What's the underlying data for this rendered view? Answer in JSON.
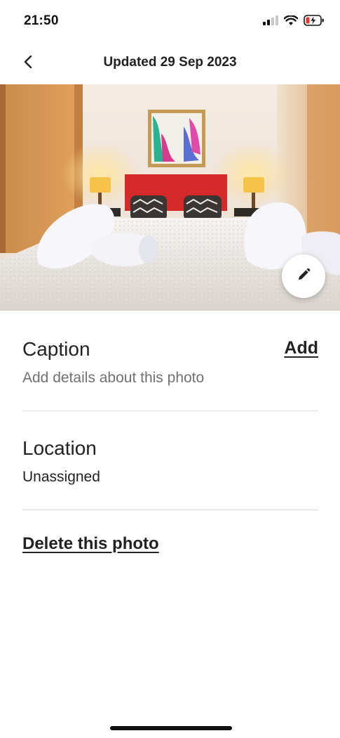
{
  "status_bar": {
    "time": "21:50",
    "icons": [
      "signal-icon",
      "wifi-icon",
      "battery-charging-icon"
    ]
  },
  "header": {
    "title": "Updated 29 Sep 2023",
    "back_icon": "chevron-left-icon"
  },
  "photo": {
    "description_icon": "pencil-icon"
  },
  "caption": {
    "title": "Caption",
    "action": "Add",
    "placeholder": "Add details about this photo"
  },
  "location": {
    "title": "Location",
    "value": "Unassigned"
  },
  "delete": {
    "label": "Delete this photo"
  },
  "colors": {
    "text": "#222222",
    "muted": "#717171",
    "divider": "#dddddd",
    "headboard": "#d62a2a"
  }
}
